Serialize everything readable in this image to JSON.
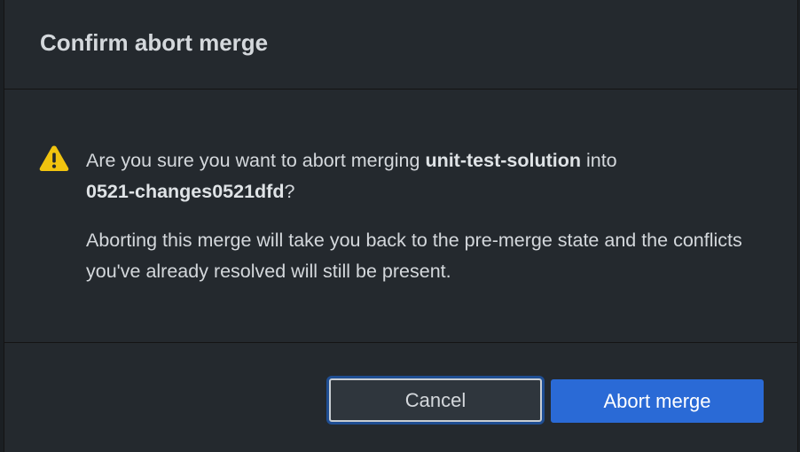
{
  "dialog": {
    "title": "Confirm abort merge",
    "warning_icon": "warning-triangle-icon",
    "accent_color": "#f1c40f",
    "message": {
      "prefix": "Are you sure you want to abort merging ",
      "source_branch": "unit-test-solution",
      "middle": " into",
      "target_branch": "0521-changes0521dfd",
      "suffix": "?"
    },
    "secondary_message": "Aborting this merge will take you back to the pre-merge state and the conflicts you've already resolved will still be present.",
    "buttons": {
      "cancel_label": "Cancel",
      "confirm_label": "Abort merge",
      "confirm_color": "#2a6ad6"
    }
  }
}
